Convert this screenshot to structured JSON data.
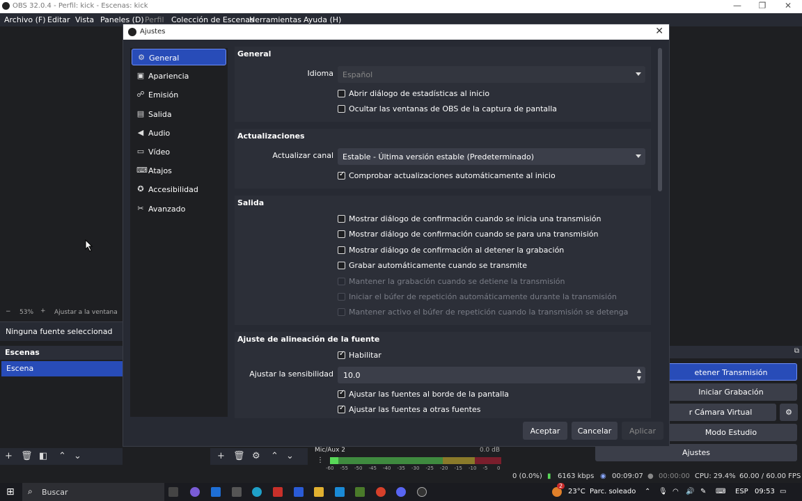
{
  "window": {
    "title": "OBS 32.0.4 - Perfil: kick - Escenas: kick",
    "controls": [
      "—",
      "❐",
      "✕"
    ]
  },
  "menu": [
    "Archivo (F)",
    "Editar",
    "Vista",
    "Paneles (D)",
    "Perfil",
    "Colección de Escenas",
    "Herramientas",
    "Ayuda (H)"
  ],
  "preview": {
    "zoom": "53%",
    "fit_label": "Ajustar a la ventana",
    "no_source": "Ninguna fuente seleccionad"
  },
  "scenes": {
    "header": "Escenas",
    "items": [
      "Escena"
    ]
  },
  "mixer": {
    "label": "Mic/Aux 2",
    "db": "0.0 dB",
    "scale": [
      "-60",
      "-55",
      "-50",
      "-45",
      "-40",
      "-35",
      "-30",
      "-25",
      "-20",
      "-15",
      "-10",
      "-5",
      "0"
    ],
    "level_fraction": 0.8
  },
  "controls": {
    "stop_stream": "etener Transmisión",
    "start_record": "Iniciar Grabación",
    "virtual_cam": "r Cámara Virtual",
    "studio_mode": "Modo Estudio",
    "settings": "Ajustes"
  },
  "status": {
    "dropped": "0 (0.0%)",
    "kbps": "6163 kbps",
    "stream_time": "00:09:07",
    "rec_time": "00:00:00",
    "cpu": "CPU: 29.4%",
    "fps": "60.00 / 60.00 FPS"
  },
  "taskbar": {
    "search": "Buscar",
    "weather_temp": "23°C",
    "weather_desc": "Parc. soleado",
    "lang": "ESP",
    "time": "09:53",
    "badge": "2"
  },
  "dialog": {
    "title": "Ajustes",
    "nav": [
      {
        "label": "General",
        "icon": "⚙"
      },
      {
        "label": "Apariencia",
        "icon": "▣"
      },
      {
        "label": "Emisión",
        "icon": "☍"
      },
      {
        "label": "Salida",
        "icon": "▤"
      },
      {
        "label": "Audio",
        "icon": "◀"
      },
      {
        "label": "Vídeo",
        "icon": "▭"
      },
      {
        "label": "Atajos",
        "icon": "⌨"
      },
      {
        "label": "Accesibilidad",
        "icon": "✪"
      },
      {
        "label": "Avanzado",
        "icon": "✂"
      }
    ],
    "general": {
      "title": "General",
      "language_label": "Idioma",
      "language_value": "Español",
      "stats_on_start": "Abrir diálogo de estadísticas al inicio",
      "hide_from_capture": "Ocultar las ventanas de OBS de la captura de pantalla"
    },
    "updates": {
      "title": "Actualizaciones",
      "channel_label": "Actualizar canal",
      "channel_value": "Estable - Última versión estable (Predeterminado)",
      "auto_check": "Comprobar actualizaciones automáticamente al inicio"
    },
    "output": {
      "title": "Salida",
      "items": [
        {
          "label": "Mostrar diálogo de confirmación cuando se inicia una transmisión",
          "checked": false,
          "disabled": false
        },
        {
          "label": "Mostrar diálogo de confirmación cuando se para una transmisión",
          "checked": false,
          "disabled": false
        },
        {
          "label": "Mostrar diálogo de confirmación al detener la grabación",
          "checked": false,
          "disabled": false
        },
        {
          "label": "Grabar automáticamente cuando se transmite",
          "checked": false,
          "disabled": false
        },
        {
          "label": "Mantener la grabación cuando se detiene la transmisión",
          "checked": false,
          "disabled": true
        },
        {
          "label": "Iniciar el búfer de repetición automáticamente durante la transmisión",
          "checked": false,
          "disabled": true
        },
        {
          "label": "Mantener activo el búfer de repetición cuando la transmisión se detenga",
          "checked": false,
          "disabled": true
        }
      ]
    },
    "snap": {
      "title": "Ajuste de alineación de la fuente",
      "enable": "Habilitar",
      "sensitivity_label": "Ajustar la sensibilidad",
      "sensitivity_value": "10.0",
      "screen_edge": "Ajustar las fuentes al borde de la pantalla",
      "other_sources": "Ajustar las fuentes a otras fuentes"
    },
    "buttons": {
      "accept": "Aceptar",
      "cancel": "Cancelar",
      "apply": "Aplicar"
    }
  },
  "colors": {
    "accent": "#284cb8",
    "panel": "#272a33",
    "bg": "#1e1f22"
  }
}
